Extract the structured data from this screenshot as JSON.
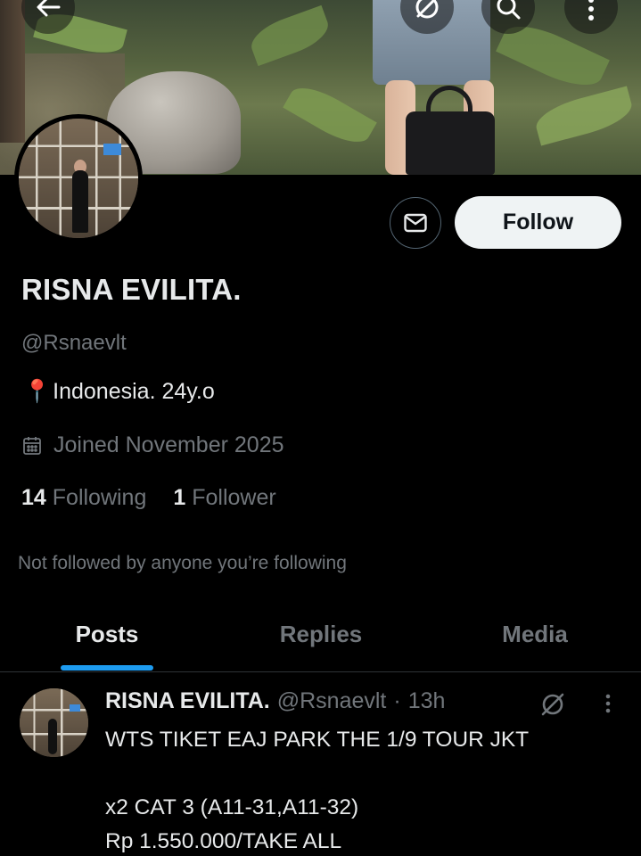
{
  "header": {
    "back_icon": "arrow-left-icon",
    "grok_icon": "grok-slash-icon",
    "search_icon": "search-icon",
    "more_icon": "more-vertical-icon"
  },
  "profile": {
    "name": "RISNA EVILITA.",
    "handle": "@Rsnaevlt",
    "bio_pin": "📍",
    "bio": "Indonesia. 24y.o",
    "joined": "Joined November 2025",
    "following_count": "14",
    "following_label": "Following",
    "followers_count": "1",
    "followers_label": "Follower",
    "not_followed": "Not followed by anyone you’re following"
  },
  "actions": {
    "follow_label": "Follow"
  },
  "tabs": [
    {
      "label": "Posts",
      "active": true
    },
    {
      "label": "Replies",
      "active": false
    },
    {
      "label": "Media",
      "active": false
    }
  ],
  "post": {
    "name": "RISNA EVILITA.",
    "handle": "@Rsnaevlt",
    "separator": "·",
    "time": "13h",
    "text": "WTS TIKET EAJ PARK THE 1/9 TOUR JKT\n\nx2 CAT 3 (A11-31,A11-32)\nRp 1.550.000/TAKE ALL"
  },
  "colors": {
    "background": "#000000",
    "text_primary": "#e7e9ea",
    "text_secondary": "#71767b",
    "accent": "#1d9bf0",
    "button_bg": "#eff3f4"
  }
}
